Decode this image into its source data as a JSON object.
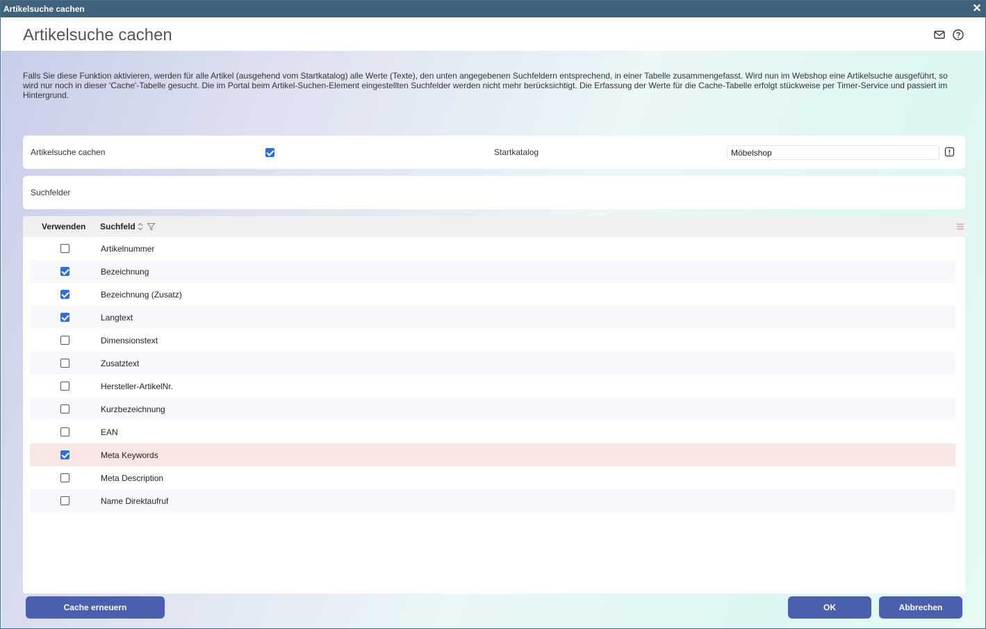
{
  "window": {
    "title": "Artikelsuche cachen",
    "close_glyph": "✕"
  },
  "header": {
    "title": "Artikelsuche cachen",
    "icons": [
      "mail-icon",
      "help-icon"
    ]
  },
  "description": "Falls Sie diese Funktion aktivieren, werden für alle Artikel (ausgehend vom Startkatalog) alle Werte (Texte), den unten angegebenen Suchfeldern entsprechend, in einer Tabelle zusammengefasst. Wird nun im Webshop eine Artikelsuche ausgeführt, so wird nur noch in dieser 'Cache'-Tabelle gesucht. Die im Portal beim Artikel-Suchen-Element eingestellten Suchfelder werden nicht mehr berücksichtigt. Die Erfassung der Werte für die Cache-Tabelle erfolgt stückweise per Timer-Service und passiert im Hintergrund.",
  "settings": {
    "cache_label": "Artikelsuche cachen",
    "cache_enabled": true,
    "startkatalog_label": "Startkatalog",
    "startkatalog_value": "Möbelshop"
  },
  "suchfelder": {
    "label": "Suchfelder"
  },
  "table": {
    "columns": [
      "Verwenden",
      "Suchfeld"
    ],
    "rows": [
      {
        "field": "Artikelnummer",
        "checked": false
      },
      {
        "field": "Bezeichnung",
        "checked": true
      },
      {
        "field": "Bezeichnung (Zusatz)",
        "checked": true
      },
      {
        "field": "Langtext",
        "checked": true
      },
      {
        "field": "Dimensionstext",
        "checked": false
      },
      {
        "field": "Zusatztext",
        "checked": false
      },
      {
        "field": "Hersteller-ArtikelNr.",
        "checked": false
      },
      {
        "field": "Kurzbezeichnung",
        "checked": false
      },
      {
        "field": "EAN",
        "checked": false
      },
      {
        "field": "Meta Keywords",
        "checked": true,
        "selected": true
      },
      {
        "field": "Meta Description",
        "checked": false
      },
      {
        "field": "Name Direktaufruf",
        "checked": false
      }
    ]
  },
  "buttons": {
    "refresh": "Cache erneuern",
    "ok": "OK",
    "cancel": "Abbrechen"
  },
  "colors": {
    "titlebar": "#3f617c",
    "button": "#4a5fae",
    "checkbox_checked": "#2f6fd6",
    "selected_row": "#f7e6e4"
  }
}
